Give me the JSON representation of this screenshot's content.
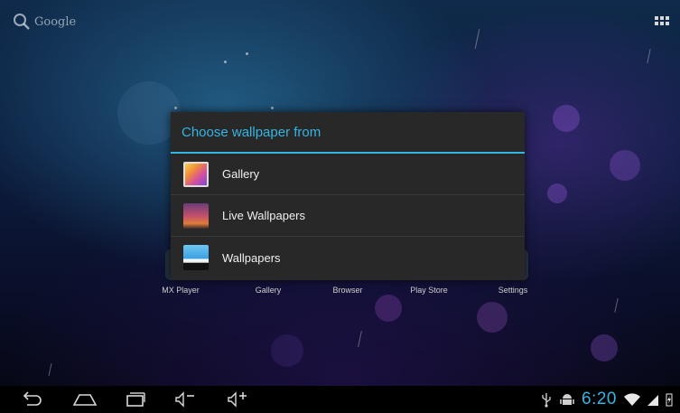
{
  "search": {
    "label": "Google"
  },
  "dock": {
    "items": [
      {
        "label": "MX Player"
      },
      {
        "label": "Gallery"
      },
      {
        "label": "Browser"
      },
      {
        "label": "Play Store"
      },
      {
        "label": "Settings"
      }
    ]
  },
  "dialog": {
    "title": "Choose wallpaper from",
    "options": [
      {
        "label": "Gallery"
      },
      {
        "label": "Live Wallpapers"
      },
      {
        "label": "Wallpapers"
      }
    ]
  },
  "status": {
    "time": "6:20"
  },
  "colors": {
    "accent": "#33b5e5",
    "dialog_bg": "#282828",
    "navbar": "#000000"
  },
  "icons": {
    "nav": [
      "back-icon",
      "home-icon",
      "recent-apps-icon",
      "volume-down-icon",
      "volume-up-icon"
    ],
    "tray": [
      "usb-icon",
      "android-debug-icon",
      "wifi-icon",
      "signal-icon",
      "battery-icon"
    ]
  }
}
